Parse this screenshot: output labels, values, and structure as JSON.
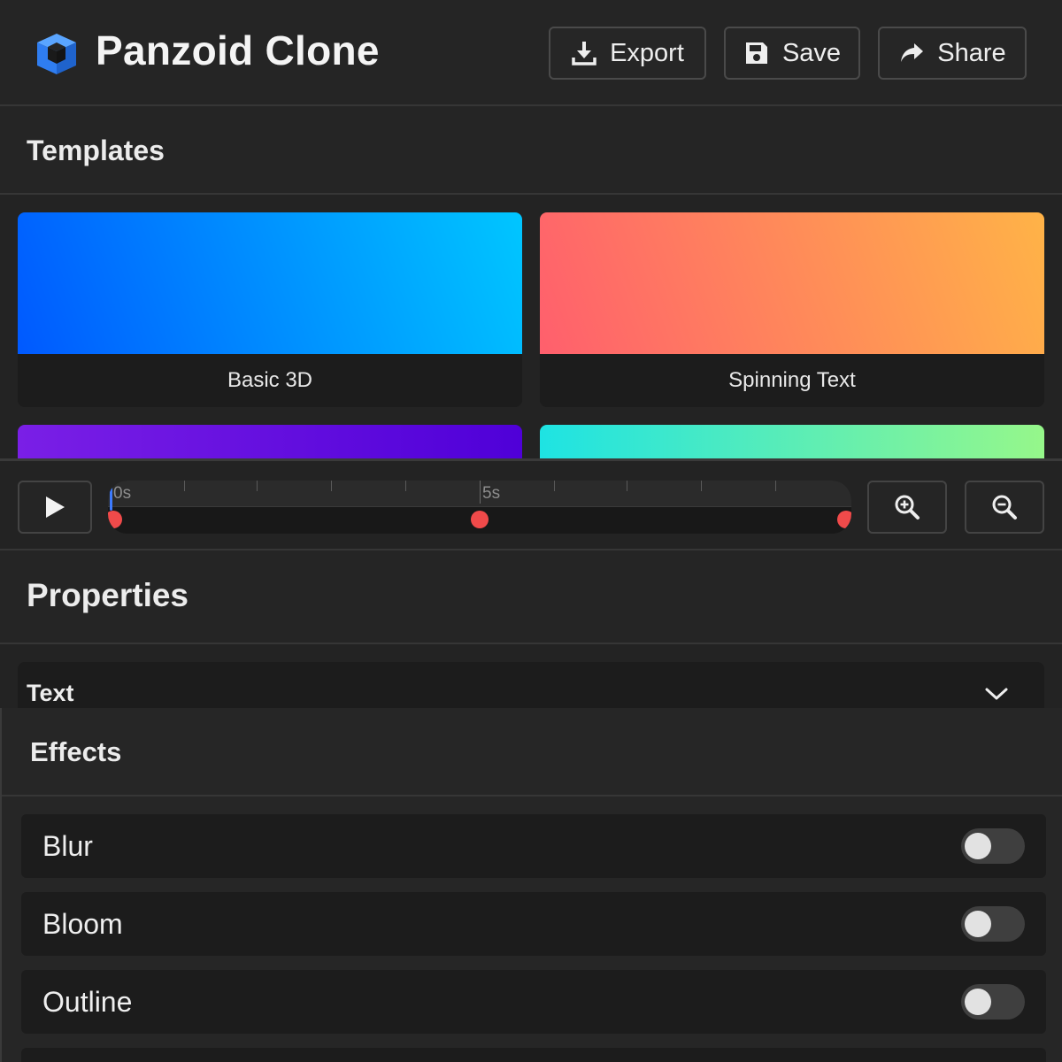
{
  "app": {
    "title": "Panzoid Clone",
    "logo_icon": "cube-icon",
    "accent_color": "#3b8cff"
  },
  "header": {
    "export_label": "Export",
    "save_label": "Save",
    "share_label": "Share",
    "export_icon": "download-icon",
    "save_icon": "floppy-disk-icon",
    "share_icon": "share-arrow-icon"
  },
  "templates": {
    "title": "Templates",
    "items": [
      {
        "label": "Basic 3D",
        "gradient": [
          "#0059ff",
          "#00c6ff"
        ]
      },
      {
        "label": "Spinning Text",
        "gradient": [
          "#ff5f6d",
          "#ffb347"
        ]
      },
      {
        "label": "",
        "gradient": [
          "#7a1fe6",
          "#4f00d8"
        ]
      },
      {
        "label": "",
        "gradient": [
          "#1ee3e3",
          "#96f78a"
        ]
      }
    ]
  },
  "timeline": {
    "play_icon": "play-icon",
    "zoom_in_icon": "zoom-in-icon",
    "zoom_out_icon": "zoom-out-icon",
    "tick_labels": [
      "0s",
      "5s"
    ],
    "keyframe_color": "#f04a4a"
  },
  "properties": {
    "title": "Properties",
    "sections": [
      {
        "label": "Text",
        "icon": "chevron-down-icon"
      }
    ]
  },
  "effects": {
    "title": "Effects",
    "items": [
      {
        "label": "Blur",
        "enabled": false
      },
      {
        "label": "Bloom",
        "enabled": false
      },
      {
        "label": "Outline",
        "enabled": false
      }
    ]
  }
}
